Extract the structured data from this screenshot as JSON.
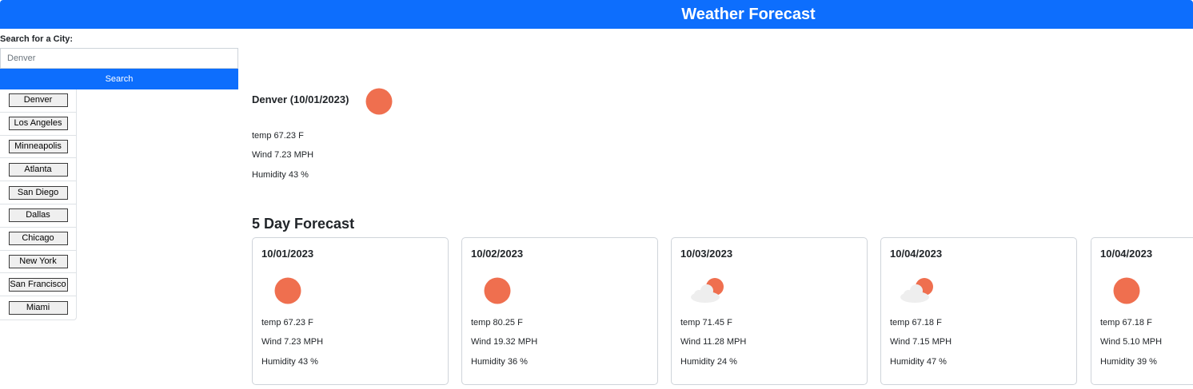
{
  "header": {
    "title": "Weather Forecast"
  },
  "search": {
    "label": "Search for a City:",
    "value": "",
    "placeholder": "Denver",
    "button_label": "Search"
  },
  "history": [
    "Denver",
    "Los Angeles",
    "Minneapolis",
    "Atlanta",
    "San Diego",
    "Dallas",
    "Chicago",
    "New York",
    "San Francisco",
    "Miami"
  ],
  "current": {
    "title": "Denver (10/01/2023)",
    "icon": "sun-icon",
    "temp": "temp 67.23 F",
    "wind": "Wind 7.23 MPH",
    "humidity": "Humidity 43 %"
  },
  "forecast": {
    "heading": "5 Day Forecast",
    "days": [
      {
        "date": "10/01/2023",
        "icon": "sun-icon",
        "temp": "temp 67.23 F",
        "wind": "Wind 7.23 MPH",
        "humidity": "Humidity 43 %"
      },
      {
        "date": "10/02/2023",
        "icon": "sun-icon",
        "temp": "temp 80.25 F",
        "wind": "Wind 19.32 MPH",
        "humidity": "Humidity 36 %"
      },
      {
        "date": "10/03/2023",
        "icon": "partly-cloudy-icon",
        "temp": "temp 71.45 F",
        "wind": "Wind 11.28 MPH",
        "humidity": "Humidity 24 %"
      },
      {
        "date": "10/04/2023",
        "icon": "partly-cloudy-icon",
        "temp": "temp 67.18 F",
        "wind": "Wind 7.15 MPH",
        "humidity": "Humidity 47 %"
      },
      {
        "date": "10/04/2023",
        "icon": "sun-icon",
        "temp": "temp 67.18 F",
        "wind": "Wind 5.10 MPH",
        "humidity": "Humidity 39 %"
      }
    ]
  },
  "colors": {
    "accent": "#0d6efd",
    "sun": "#ef6f4f",
    "cloud": "#eeeeee"
  }
}
